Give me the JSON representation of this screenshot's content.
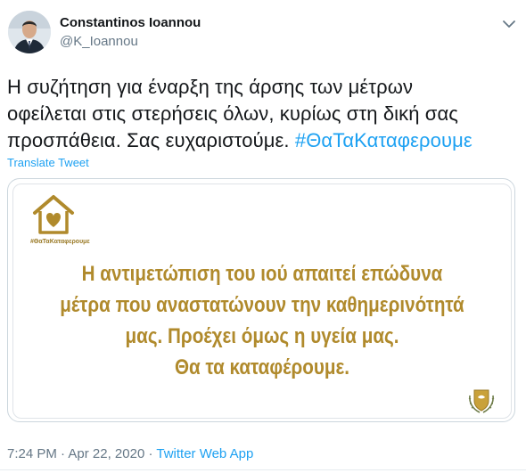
{
  "author": {
    "name": "Constantinos Ioannou",
    "handle": "@K_Ioannou"
  },
  "tweet": {
    "text_lines": [
      "Η συζήτηση για έναρξη της άρσης των μέτρων",
      "οφείλεται στις στερήσεις όλων, κυρίως στη δική σας",
      "προσπάθεια. Σας ευχαριστούμε. "
    ],
    "hashtag": "#ΘαΤαΚαταφερουμε",
    "translate_label": "Translate Tweet"
  },
  "media": {
    "logo_tag": "#ΘαΤαΚαταφερουμε",
    "lines": [
      "Η αντιμετώπιση του ιού απαιτεί επώδυνα",
      "μέτρα που αναστατώνουν την καθημερινότητά",
      "μας. Προέχει όμως η υγεία μας.",
      "Θα τα καταφέρουμε."
    ],
    "accent_color": "#b08a2c"
  },
  "meta": {
    "time": "7:24 PM",
    "separator": " · ",
    "date": "Apr 22, 2020",
    "source": "Twitter Web App"
  },
  "icons": {
    "more": "chevron-down-icon",
    "logo": "house-heart-icon",
    "emblem": "cyprus-emblem-icon"
  },
  "colors": {
    "link": "#1da1f2",
    "secondary_text": "#657786",
    "gold": "#b08a2c"
  }
}
